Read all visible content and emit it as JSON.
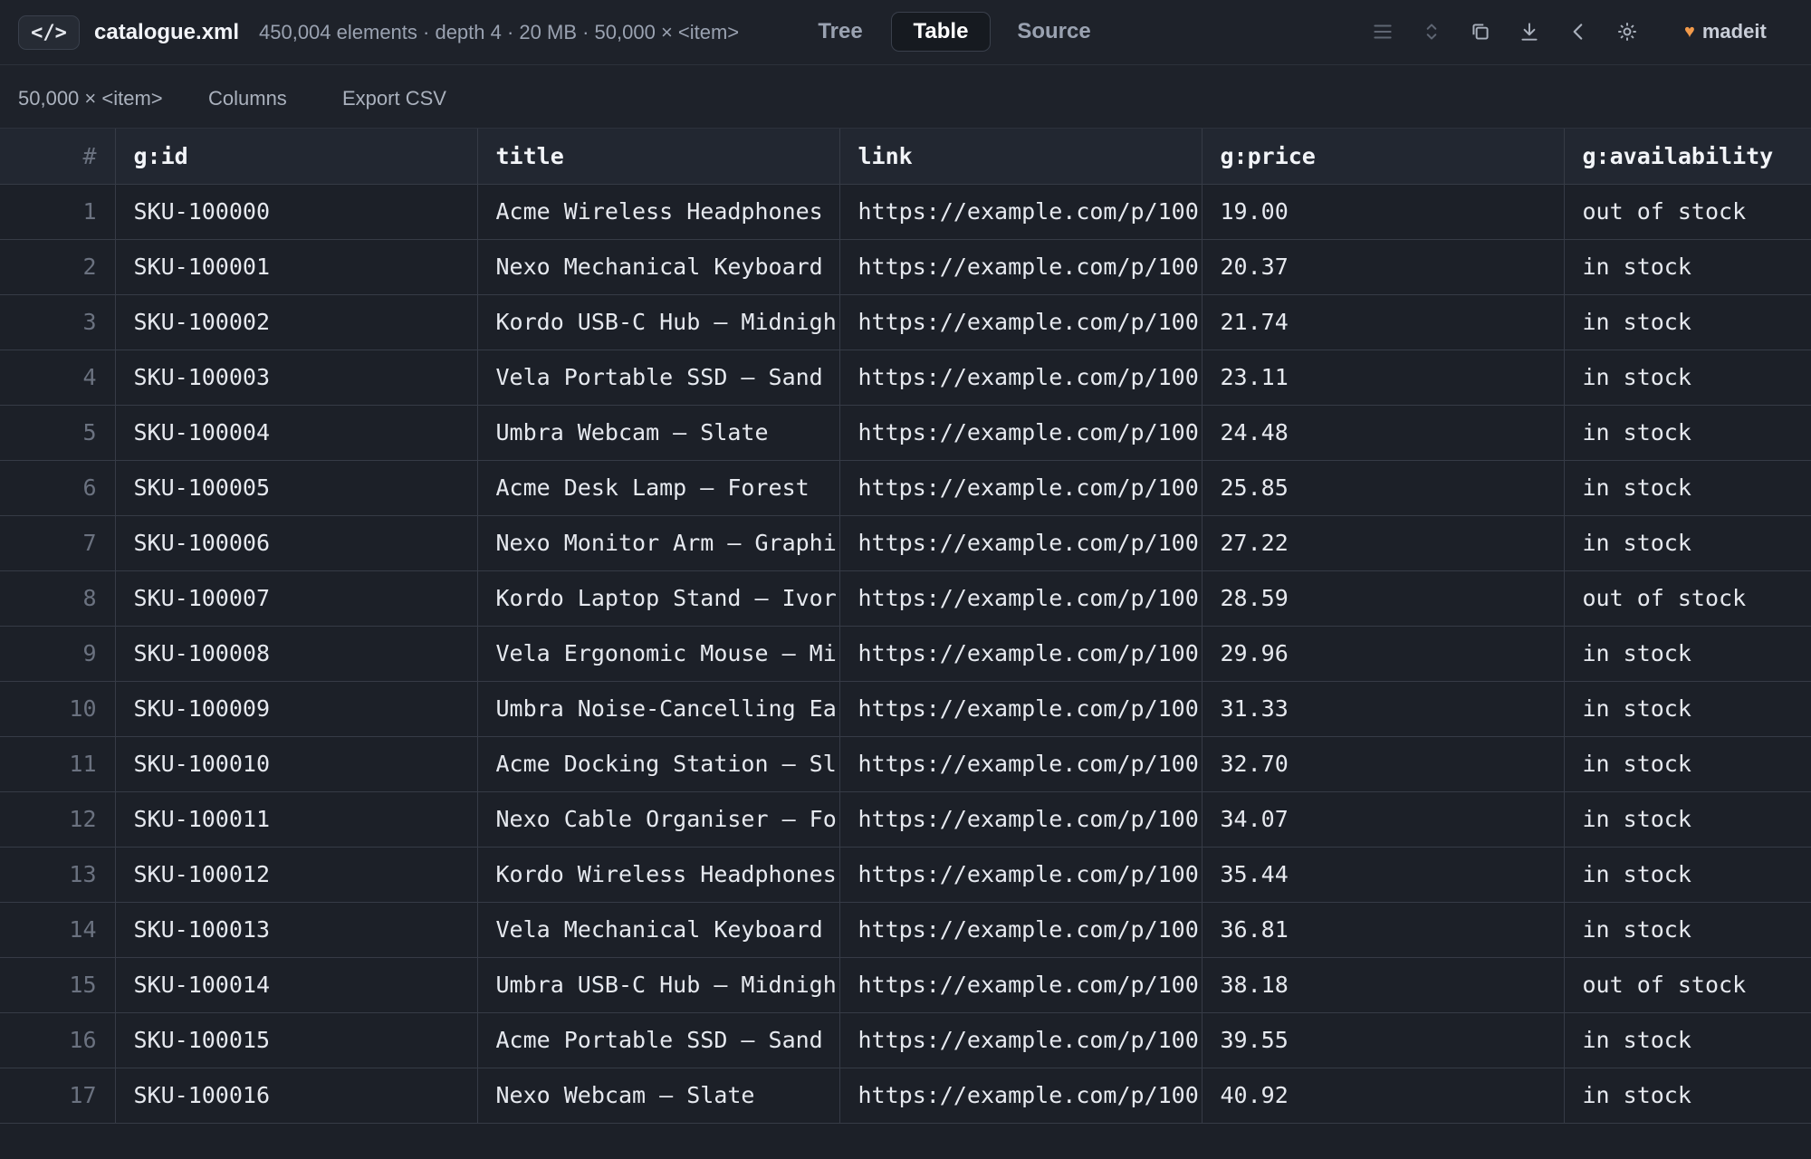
{
  "header": {
    "badge": "</>",
    "filename": "catalogue.xml",
    "meta": "450,004 elements · depth 4 · 20 MB · 50,000 × <item>",
    "tabs": [
      "Tree",
      "Table",
      "Source"
    ],
    "active_tab": "Table",
    "icons": [
      "menu-icon",
      "expand-collapse-icon",
      "copy-icon",
      "download-icon",
      "chevron-left-icon",
      "gear-icon"
    ],
    "user": "madeit",
    "accent": "#f29a4a"
  },
  "subbar": {
    "count": "50,000 × <item>",
    "columns_label": "Columns",
    "export_label": "Export CSV"
  },
  "table": {
    "headers": [
      "#",
      "g:id",
      "title",
      "link",
      "g:price",
      "g:availability"
    ],
    "rows": [
      [
        "1",
        "SKU-100000",
        "Acme Wireless Headphones - ",
        "https://example.com/p/100",
        "19.00",
        "out of stock"
      ],
      [
        "2",
        "SKU-100001",
        "Nexo Mechanical Keyboard - ",
        "https://example.com/p/100",
        "20.37",
        "in stock"
      ],
      [
        "3",
        "SKU-100002",
        "Kordo USB-C Hub — Midnigh",
        "https://example.com/p/100",
        "21.74",
        "in stock"
      ],
      [
        "4",
        "SKU-100003",
        "Vela Portable SSD — Sand",
        "https://example.com/p/100",
        "23.11",
        "in stock"
      ],
      [
        "5",
        "SKU-100004",
        "Umbra Webcam — Slate",
        "https://example.com/p/100",
        "24.48",
        "in stock"
      ],
      [
        "6",
        "SKU-100005",
        "Acme Desk Lamp — Forest",
        "https://example.com/p/100",
        "25.85",
        "in stock"
      ],
      [
        "7",
        "SKU-100006",
        "Nexo Monitor Arm — Graphi",
        "https://example.com/p/100",
        "27.22",
        "in stock"
      ],
      [
        "8",
        "SKU-100007",
        "Kordo Laptop Stand — Ivor",
        "https://example.com/p/100",
        "28.59",
        "out of stock"
      ],
      [
        "9",
        "SKU-100008",
        "Vela Ergonomic Mouse — Mi",
        "https://example.com/p/100",
        "29.96",
        "in stock"
      ],
      [
        "10",
        "SKU-100009",
        "Umbra Noise-Cancelling Ea",
        "https://example.com/p/100",
        "31.33",
        "in stock"
      ],
      [
        "11",
        "SKU-100010",
        "Acme Docking Station — Sl",
        "https://example.com/p/100",
        "32.70",
        "in stock"
      ],
      [
        "12",
        "SKU-100011",
        "Nexo Cable Organiser — Fo",
        "https://example.com/p/100",
        "34.07",
        "in stock"
      ],
      [
        "13",
        "SKU-100012",
        "Kordo Wireless Headphones",
        "https://example.com/p/100",
        "35.44",
        "in stock"
      ],
      [
        "14",
        "SKU-100013",
        "Vela Mechanical Keyboard - ",
        "https://example.com/p/100",
        "36.81",
        "in stock"
      ],
      [
        "15",
        "SKU-100014",
        "Umbra USB-C Hub — Midnigh",
        "https://example.com/p/100",
        "38.18",
        "out of stock"
      ],
      [
        "16",
        "SKU-100015",
        "Acme Portable SSD — Sand",
        "https://example.com/p/100",
        "39.55",
        "in stock"
      ],
      [
        "17",
        "SKU-100016",
        "Nexo Webcam — Slate",
        "https://example.com/p/100",
        "40.92",
        "in stock"
      ]
    ]
  }
}
